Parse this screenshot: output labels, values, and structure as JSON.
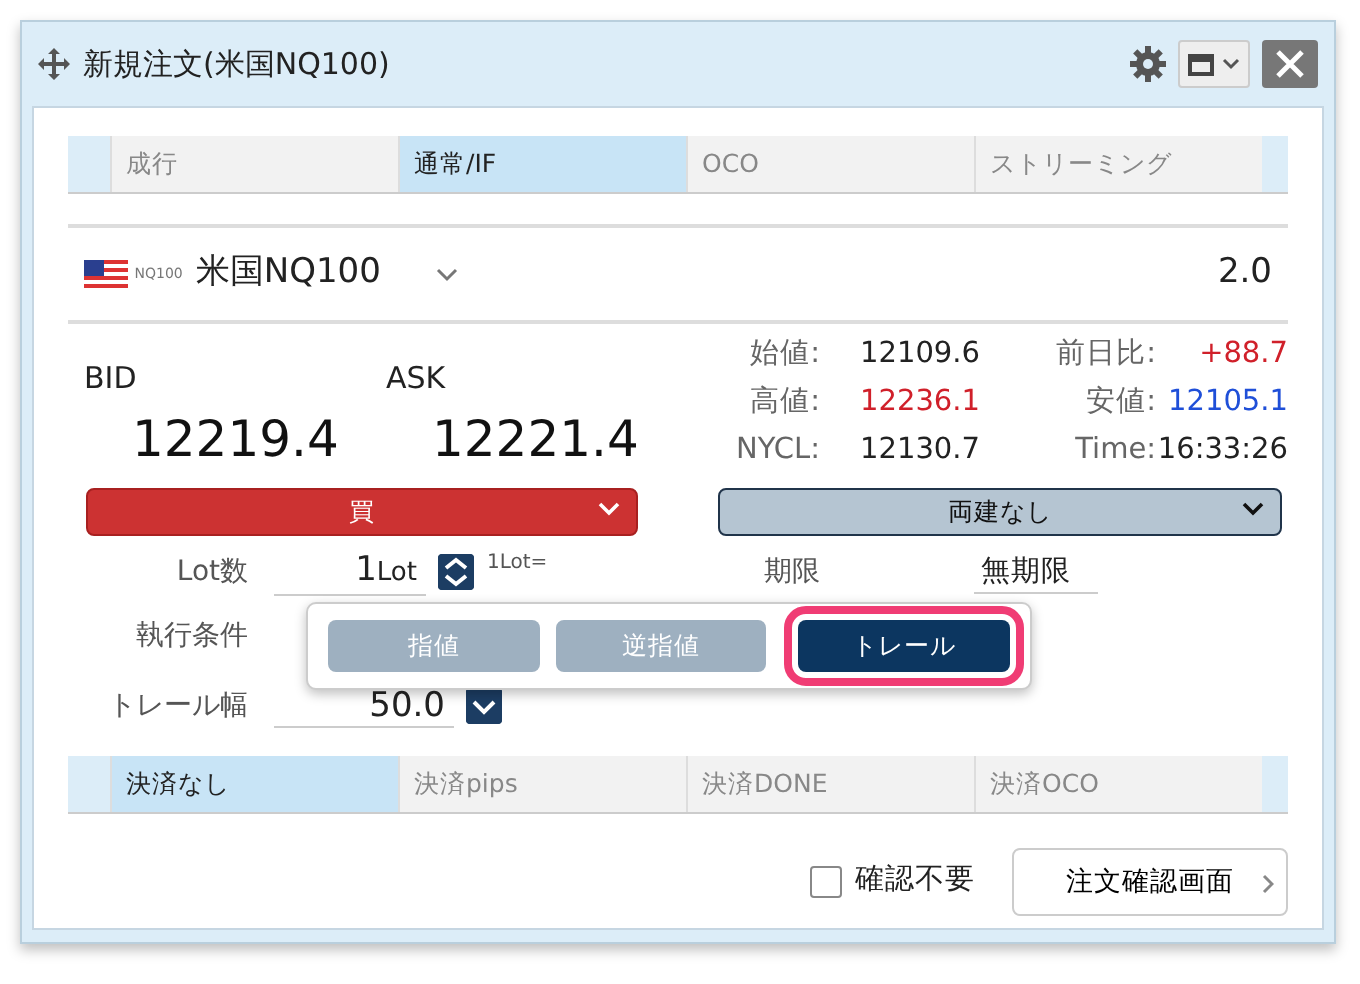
{
  "window": {
    "title": "新規注文(米国NQ100)"
  },
  "order_tabs": [
    {
      "label": "成行",
      "selected": false
    },
    {
      "label": "通常/IF",
      "selected": true
    },
    {
      "label": "OCO",
      "selected": false
    },
    {
      "label": "ストリーミング",
      "selected": false
    }
  ],
  "symbol": {
    "flag_label": "NQ100",
    "name": "米国NQ100",
    "lot_size": "2.0"
  },
  "quote": {
    "bid_label": "BID",
    "ask_label": "ASK",
    "bid": "12219.4",
    "ask": "12221.4"
  },
  "stats": [
    {
      "label": "始値:",
      "value": "12109.6",
      "color": "#222222"
    },
    {
      "label": "前日比:",
      "value": "+88.7",
      "color": "#d0202a"
    },
    {
      "label": "高値:",
      "value": "12236.1",
      "color": "#d0202a"
    },
    {
      "label": "安値:",
      "value": "12105.1",
      "color": "#1f4fd8"
    },
    {
      "label": "NYCL:",
      "value": "12130.7",
      "color": "#222222"
    },
    {
      "label": "Time:",
      "value": "16:33:26",
      "color": "#222222"
    }
  ],
  "side_select": {
    "value": "買",
    "kind": "buy"
  },
  "hedge_select": {
    "value": "両建なし"
  },
  "form": {
    "lot_label": "Lot数",
    "lot_value": "1",
    "lot_unit": "Lot",
    "lot_note": "1Lot=",
    "expiry_label": "期限",
    "expiry_value": "無期限",
    "condition_label": "執行条件",
    "trail_label": "トレール幅",
    "trail_value": "50.0"
  },
  "condition_popup": {
    "options": [
      {
        "label": "指値",
        "selected": false
      },
      {
        "label": "逆指値",
        "selected": false
      },
      {
        "label": "トレール",
        "selected": true
      }
    ]
  },
  "settle_tabs": [
    {
      "label": "決済なし",
      "selected": true
    },
    {
      "label": "決済pips",
      "selected": false
    },
    {
      "label": "決済DONE",
      "selected": false
    },
    {
      "label": "決済OCO",
      "selected": false
    }
  ],
  "skip_confirm": {
    "label": "確認不要",
    "checked": false
  },
  "confirm_button": "注文確認画面"
}
